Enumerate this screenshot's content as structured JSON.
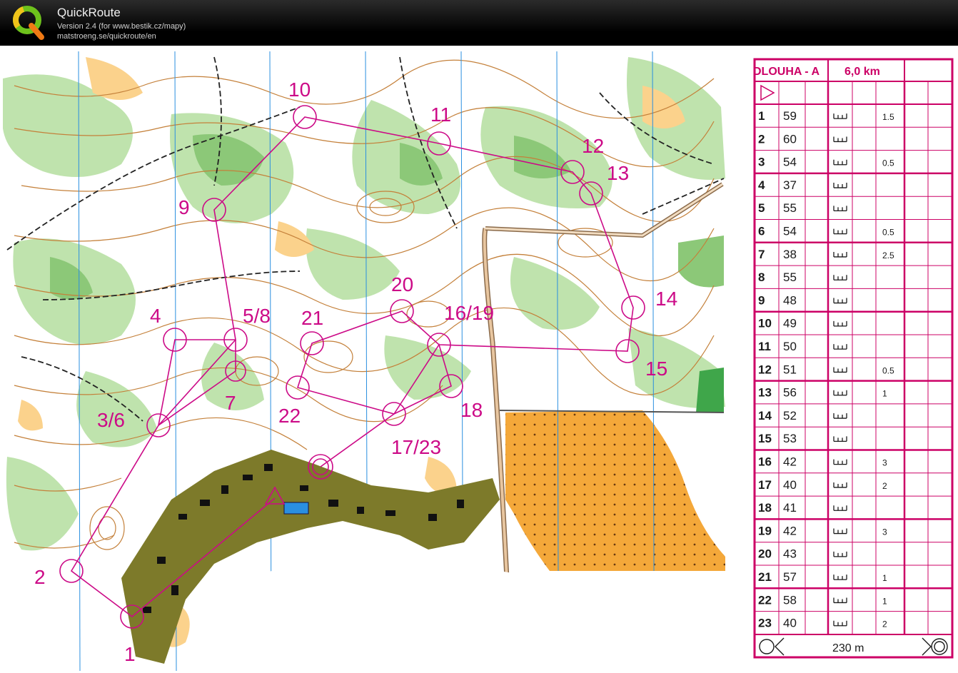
{
  "window": {
    "title": "QuickRoute",
    "version": "Version 2.4  (for www.bestik.cz/mapy)",
    "url": "matstroeng.se/quickroute/en"
  },
  "colors": {
    "course": "#cc0a87",
    "forest_green": "#9fd08a",
    "open_yellow": "#f7b95a",
    "contour": "#c4803a",
    "settlement": "#7d7a2a",
    "water": "#2a8fe0"
  },
  "course": {
    "name": "DLOUHA - A",
    "length": "6,0 km",
    "finish_distance": "230 m",
    "controls": [
      {
        "label": "1"
      },
      {
        "label": "2"
      },
      {
        "label": "3/6"
      },
      {
        "label": "4"
      },
      {
        "label": "5/8"
      },
      {
        "label": "7"
      },
      {
        "label": "9"
      },
      {
        "label": "10"
      },
      {
        "label": "11"
      },
      {
        "label": "12"
      },
      {
        "label": "13"
      },
      {
        "label": "14"
      },
      {
        "label": "15"
      },
      {
        "label": "16/19"
      },
      {
        "label": "17/23"
      },
      {
        "label": "18"
      },
      {
        "label": "20"
      },
      {
        "label": "21"
      },
      {
        "label": "22"
      }
    ]
  },
  "description_rows": [
    {
      "num": "1",
      "code": "59",
      "extra": "1.5"
    },
    {
      "num": "2",
      "code": "60",
      "extra": ""
    },
    {
      "num": "3",
      "code": "54",
      "extra": "0.5"
    },
    {
      "num": "4",
      "code": "37",
      "extra": ""
    },
    {
      "num": "5",
      "code": "55",
      "extra": ""
    },
    {
      "num": "6",
      "code": "54",
      "extra": "0.5"
    },
    {
      "num": "7",
      "code": "38",
      "extra": "2.5"
    },
    {
      "num": "8",
      "code": "55",
      "extra": ""
    },
    {
      "num": "9",
      "code": "48",
      "extra": ""
    },
    {
      "num": "10",
      "code": "49",
      "extra": ""
    },
    {
      "num": "11",
      "code": "50",
      "extra": ""
    },
    {
      "num": "12",
      "code": "51",
      "extra": "0.5"
    },
    {
      "num": "13",
      "code": "56",
      "extra": "1"
    },
    {
      "num": "14",
      "code": "52",
      "extra": ""
    },
    {
      "num": "15",
      "code": "53",
      "extra": ""
    },
    {
      "num": "16",
      "code": "42",
      "extra": "3"
    },
    {
      "num": "17",
      "code": "40",
      "extra": "2"
    },
    {
      "num": "18",
      "code": "41",
      "extra": ""
    },
    {
      "num": "19",
      "code": "42",
      "extra": "3"
    },
    {
      "num": "20",
      "code": "43",
      "extra": ""
    },
    {
      "num": "21",
      "code": "57",
      "extra": "1"
    },
    {
      "num": "22",
      "code": "58",
      "extra": "1"
    },
    {
      "num": "23",
      "code": "40",
      "extra": "2"
    }
  ]
}
